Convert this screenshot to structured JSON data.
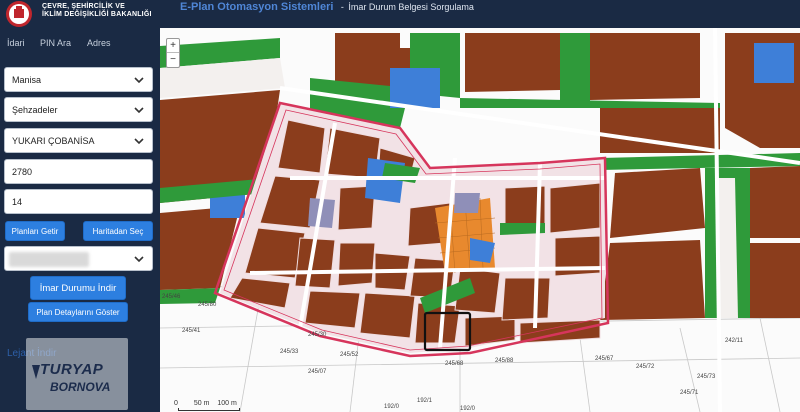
{
  "header": {
    "ministry_line1": "ÇEVRE, ŞEHİRCİLİK VE",
    "ministry_line2": "İKLİM DEĞİŞİKLİĞİ BAKANLIĞI",
    "app_title": "E-Plan Otomasyon Sistemleri",
    "separator": "-",
    "app_subtitle": "İmar Durum Belgesi Sorgulama"
  },
  "tabs": [
    {
      "label": "İdari"
    },
    {
      "label": "PIN Ara"
    },
    {
      "label": "Adres"
    }
  ],
  "form": {
    "il": "Manisa",
    "ilce": "Şehzadeler",
    "mahalle": "YUKARI ÇOBANİSA",
    "ada": "2780",
    "parsel": "14"
  },
  "buttons": {
    "planlari_getir": "Planları Getir",
    "haritadan_sec": "Haritadan Seç",
    "imar_durumu_indir": "İmar Durumu İndir",
    "plan_detaylari": "Plan Detaylarını Göster"
  },
  "lejant": "Lejant İndir",
  "watermark": {
    "line1": "TURYAP",
    "line2": "BORNOVA"
  },
  "map": {
    "zoom_in": "+",
    "zoom_out": "−",
    "scale_labels": [
      "0",
      "50 m",
      "100 m"
    ],
    "parcel_labels": [
      "245/46",
      "245/80",
      "245/41",
      "245/30",
      "245/33",
      "245/88",
      "245/68",
      "245/67",
      "245/72",
      "245/73",
      "245/71",
      "242/11",
      "192/1",
      "192/0",
      "192/0",
      "245/52",
      "245/07"
    ],
    "colors": {
      "residential": "#8b3d1c",
      "green": "#2f9a3a",
      "blue": "#3e7fd8",
      "plan_boundary": "#d6355c",
      "background": "#fbfbfb"
    }
  }
}
